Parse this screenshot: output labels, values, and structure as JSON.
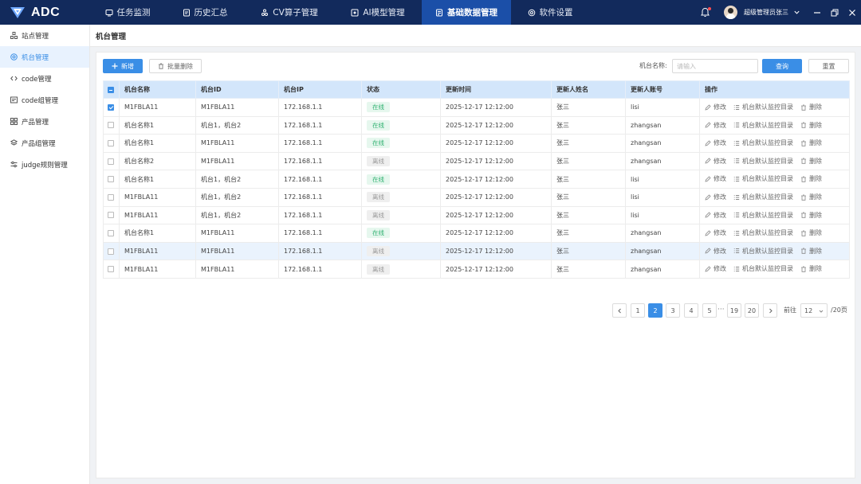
{
  "app": {
    "logo_text": "ADC"
  },
  "nav": [
    {
      "label": "任务监测",
      "icon": "monitor-icon"
    },
    {
      "label": "历史汇总",
      "icon": "history-icon"
    },
    {
      "label": "CV算子管理",
      "icon": "operator-icon"
    },
    {
      "label": "AI模型管理",
      "icon": "ai-model-icon"
    },
    {
      "label": "基础数据管理",
      "icon": "data-icon",
      "active": true
    },
    {
      "label": "软件设置",
      "icon": "settings-icon"
    }
  ],
  "user": {
    "name": "超级管理员张三"
  },
  "sidebar": [
    {
      "label": "站点管理",
      "icon": "site-icon"
    },
    {
      "label": "机台管理",
      "icon": "machine-icon",
      "active": true
    },
    {
      "label": "code管理",
      "icon": "code-icon"
    },
    {
      "label": "code组管理",
      "icon": "code-group-icon"
    },
    {
      "label": "产品管理",
      "icon": "product-icon"
    },
    {
      "label": "产品组管理",
      "icon": "product-group-icon"
    },
    {
      "label": "judge规则管理",
      "icon": "rules-icon"
    }
  ],
  "page": {
    "title": "机台管理"
  },
  "toolbar": {
    "add_label": "新增",
    "batch_delete_label": "批量删除",
    "search_label": "机台名称:",
    "search_placeholder": "请输入",
    "query_label": "查询",
    "reset_label": "重置"
  },
  "table": {
    "columns": [
      "机台名称",
      "机台ID",
      "机台IP",
      "状态",
      "更新时间",
      "更新人姓名",
      "更新人账号",
      "操作"
    ],
    "actions": {
      "edit": "修改",
      "monitor": "机台默认监控目录",
      "delete": "删除"
    },
    "rows": [
      {
        "name": "M1FBLA11",
        "id": "M1FBLA11",
        "ip": "172.168.1.1",
        "status": "在线",
        "online": true,
        "time": "2025-12-17  12:12:00",
        "updater": "张三",
        "account": "lisi",
        "checked": true
      },
      {
        "name": "机台名称1",
        "id": "机台1，机台2",
        "ip": "172.168.1.1",
        "status": "在线",
        "online": true,
        "time": "2025-12-17  12:12:00",
        "updater": "张三",
        "account": "zhangsan"
      },
      {
        "name": "机台名称1",
        "id": "M1FBLA11",
        "ip": "172.168.1.1",
        "status": "在线",
        "online": true,
        "time": "2025-12-17  12:12:00",
        "updater": "张三",
        "account": "zhangsan"
      },
      {
        "name": "机台名称2",
        "id": "M1FBLA11",
        "ip": "172.168.1.1",
        "status": "离线",
        "online": false,
        "time": "2025-12-17  12:12:00",
        "updater": "张三",
        "account": "zhangsan"
      },
      {
        "name": "机台名称1",
        "id": "机台1，机台2",
        "ip": "172.168.1.1",
        "status": "在线",
        "online": true,
        "time": "2025-12-17  12:12:00",
        "updater": "张三",
        "account": "lisi"
      },
      {
        "name": "M1FBLA11",
        "id": "机台1，机台2",
        "ip": "172.168.1.1",
        "status": "离线",
        "online": false,
        "time": "2025-12-17  12:12:00",
        "updater": "张三",
        "account": "lisi"
      },
      {
        "name": "M1FBLA11",
        "id": "机台1，机台2",
        "ip": "172.168.1.1",
        "status": "离线",
        "online": false,
        "time": "2025-12-17  12:12:00",
        "updater": "张三",
        "account": "lisi"
      },
      {
        "name": "机台名称1",
        "id": "M1FBLA11",
        "ip": "172.168.1.1",
        "status": "在线",
        "online": true,
        "time": "2025-12-17  12:12:00",
        "updater": "张三",
        "account": "zhangsan"
      },
      {
        "name": "M1FBLA11",
        "id": "M1FBLA11",
        "ip": "172.168.1.1",
        "status": "离线",
        "online": false,
        "time": "2025-12-17  12:12:00",
        "updater": "张三",
        "account": "zhangsan",
        "highlight": true
      },
      {
        "name": "M1FBLA11",
        "id": "M1FBLA11",
        "ip": "172.168.1.1",
        "status": "离线",
        "online": false,
        "time": "2025-12-17  12:12:00",
        "updater": "张三",
        "account": "zhangsan"
      }
    ]
  },
  "pagination": {
    "pages": [
      "1",
      "2",
      "3",
      "4",
      "5"
    ],
    "current": "2",
    "ellipsis": "···",
    "tail_pages": [
      "19",
      "20"
    ],
    "goto_label": "前往",
    "page_size": "12",
    "total_label": "/20页"
  },
  "colors": {
    "topbar": "#122a5c",
    "nav_active": "#1b4fa8",
    "primary": "#3a8ee6",
    "table_header": "#d3e6fb",
    "online": "#2fb170"
  }
}
